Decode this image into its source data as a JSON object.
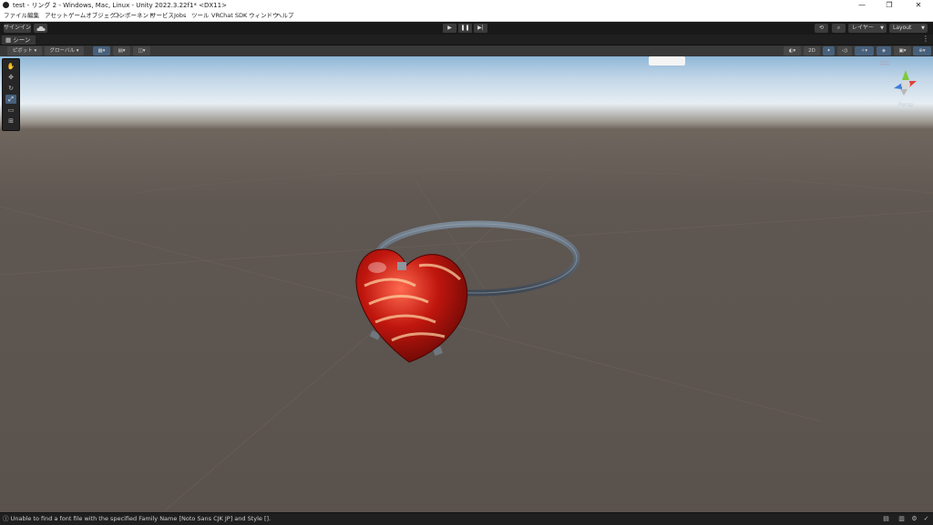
{
  "window": {
    "title": "test - リング 2 - Windows, Mac, Linux - Unity 2022.3.22f1* <DX11>",
    "minimize": "—",
    "maximize": "❐",
    "close": "✕"
  },
  "menu": [
    "ファイル",
    "編集",
    "アセット",
    "ゲームオブジェクト",
    "コンポーネント",
    "サービス",
    "Jobs",
    "ツール",
    "VRChat SDK",
    "ウィンドウ",
    "ヘルプ"
  ],
  "toolbar": {
    "signin_label": "サインイン",
    "play": "▶",
    "pause": "❚❚",
    "step": "▶|",
    "layers_label": "レイヤー",
    "layout_label": "Layout"
  },
  "tabs": {
    "scene_label": "シーン"
  },
  "scene_toolbar": {
    "pivot_label": "ピボット",
    "global_label": "グローバル",
    "mode_2d": "2D"
  },
  "gizmo": {
    "projection_label": "Persp"
  },
  "tools": [
    "view-tool",
    "move-tool",
    "rotate-tool",
    "scale-tool",
    "rect-tool",
    "transform-tool"
  ],
  "status": {
    "message": "Unable to find a font file with the specified Family Name [Noto Sans CJK JP] and Style []."
  },
  "colors": {
    "accent": "#46607c",
    "heart": "#c0160e",
    "ring": "#5a6a7a"
  }
}
